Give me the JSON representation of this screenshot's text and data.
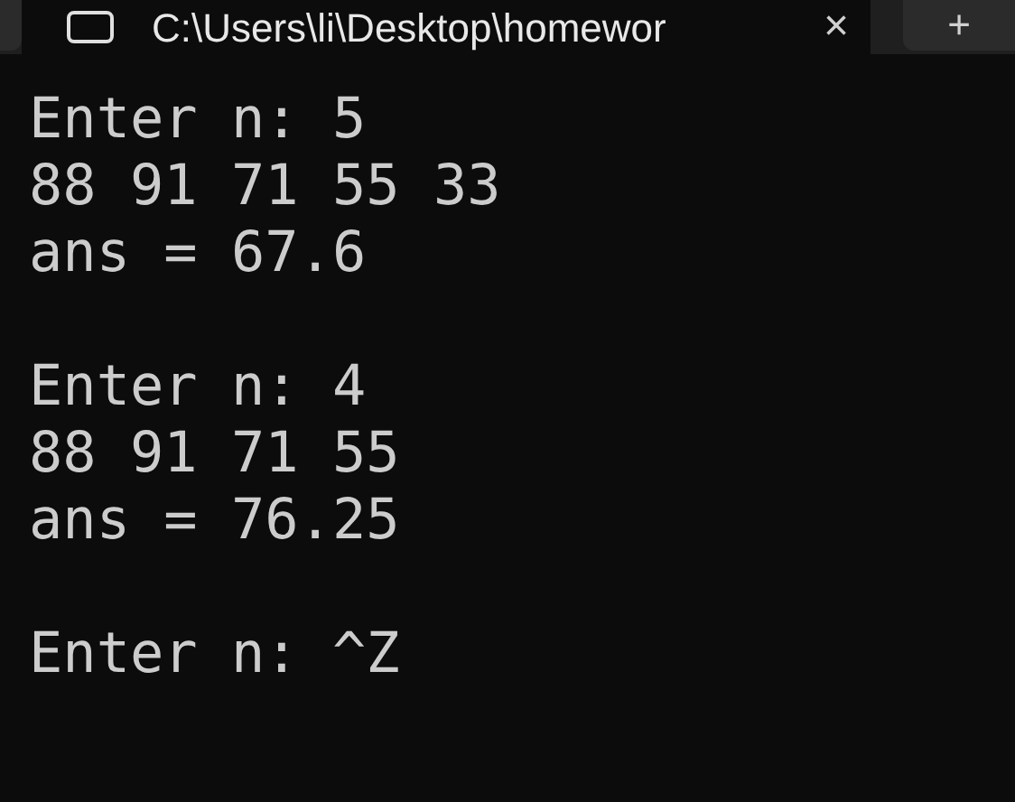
{
  "tab": {
    "title": "C:\\Users\\li\\Desktop\\homewor",
    "close": "×",
    "new_tab": "+"
  },
  "terminal": {
    "blocks": [
      {
        "lines": [
          "Enter n: 5",
          "88 91 71 55 33",
          "ans = 67.6"
        ]
      },
      {
        "lines": [
          "Enter n: 4",
          "88 91 71 55",
          "ans = 76.25"
        ]
      },
      {
        "lines": [
          "Enter n: ^Z"
        ]
      }
    ]
  }
}
